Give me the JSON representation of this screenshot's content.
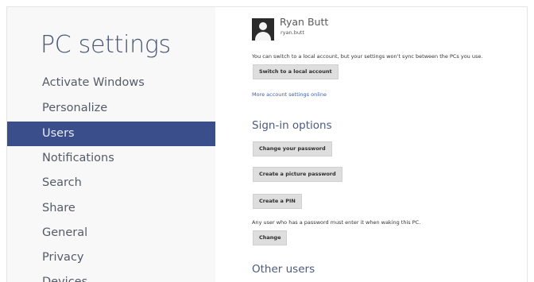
{
  "left": {
    "title": "PC settings",
    "nav": [
      {
        "label": "Activate Windows",
        "selected": false
      },
      {
        "label": "Personalize",
        "selected": false
      },
      {
        "label": "Users",
        "selected": true
      },
      {
        "label": "Notifications",
        "selected": false
      },
      {
        "label": "Search",
        "selected": false
      },
      {
        "label": "Share",
        "selected": false
      },
      {
        "label": "General",
        "selected": false
      },
      {
        "label": "Privacy",
        "selected": false
      },
      {
        "label": "Devices",
        "selected": false
      }
    ]
  },
  "account": {
    "name": "Ryan Butt",
    "id": "ryan.butt",
    "switch_note": "You can switch to a local account, but your settings won't sync between the PCs you use.",
    "switch_button": "Switch to a local account",
    "more_link": "More account settings online"
  },
  "signin": {
    "heading": "Sign-in options",
    "change_password_button": "Change your password",
    "picture_password_button": "Create a picture password",
    "pin_button": "Create a PIN",
    "waking_note": "Any user who has a password must enter it when waking this PC.",
    "change_button": "Change"
  },
  "other_users": {
    "heading": "Other users"
  },
  "colors": {
    "selected_nav": "#3a4e8c",
    "title": "#4a5673",
    "link": "#3a5db0"
  }
}
